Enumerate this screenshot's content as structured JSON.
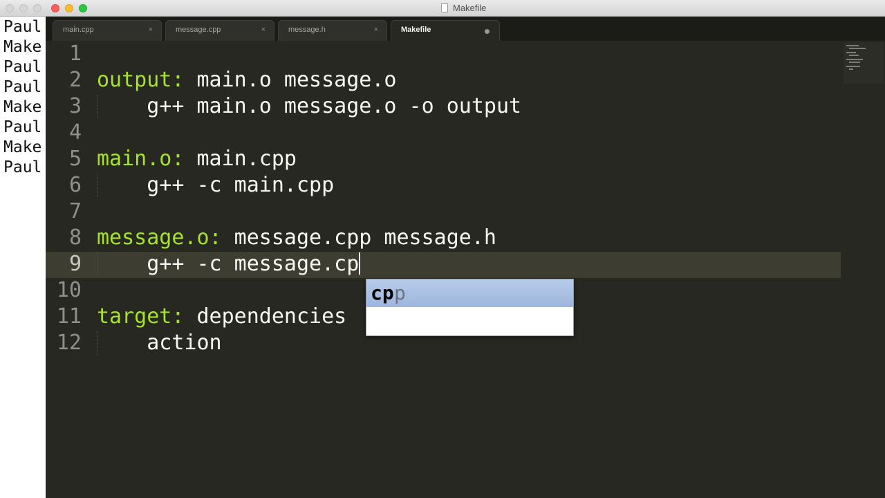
{
  "window": {
    "title": "Makefile"
  },
  "terminal": {
    "lines": [
      "Paul",
      "Make",
      "Paul",
      "Paul",
      "Make",
      "Paul",
      "Make",
      "Paul"
    ]
  },
  "tabs": [
    {
      "label": "main.cpp",
      "close": "×"
    },
    {
      "label": "message.cpp",
      "close": "×"
    },
    {
      "label": "message.h",
      "close": "×"
    },
    {
      "label": "Makefile",
      "active": true,
      "unsaved": true
    }
  ],
  "editor": {
    "current_line": 9,
    "lines": [
      {
        "num": "1",
        "target": "",
        "rest": ""
      },
      {
        "num": "2",
        "target": "output:",
        "rest": " main.o message.o"
      },
      {
        "num": "3",
        "target": "",
        "rest": "    g++ main.o message.o -o output"
      },
      {
        "num": "4",
        "target": "",
        "rest": ""
      },
      {
        "num": "5",
        "target": "main.o:",
        "rest": " main.cpp"
      },
      {
        "num": "6",
        "target": "",
        "rest": "    g++ -c main.cpp"
      },
      {
        "num": "7",
        "target": "",
        "rest": ""
      },
      {
        "num": "8",
        "target": "message.o:",
        "rest": " message.cpp message.h"
      },
      {
        "num": "9",
        "target": "",
        "rest": "    g++ -c message.cp"
      },
      {
        "num": "10",
        "target": "",
        "rest": ""
      },
      {
        "num": "11",
        "target": "target:",
        "rest": " dependencies"
      },
      {
        "num": "12",
        "target": "",
        "rest": "    action"
      }
    ]
  },
  "autocomplete": {
    "typed": "cp",
    "completion": "p"
  },
  "colors": {
    "editor_bg": "#272822",
    "target": "#a6e22e",
    "text": "#f8f8f2",
    "line_number": "#90908a",
    "current_line": "#3e3d32",
    "popup_selected": "#a9bfe3"
  }
}
